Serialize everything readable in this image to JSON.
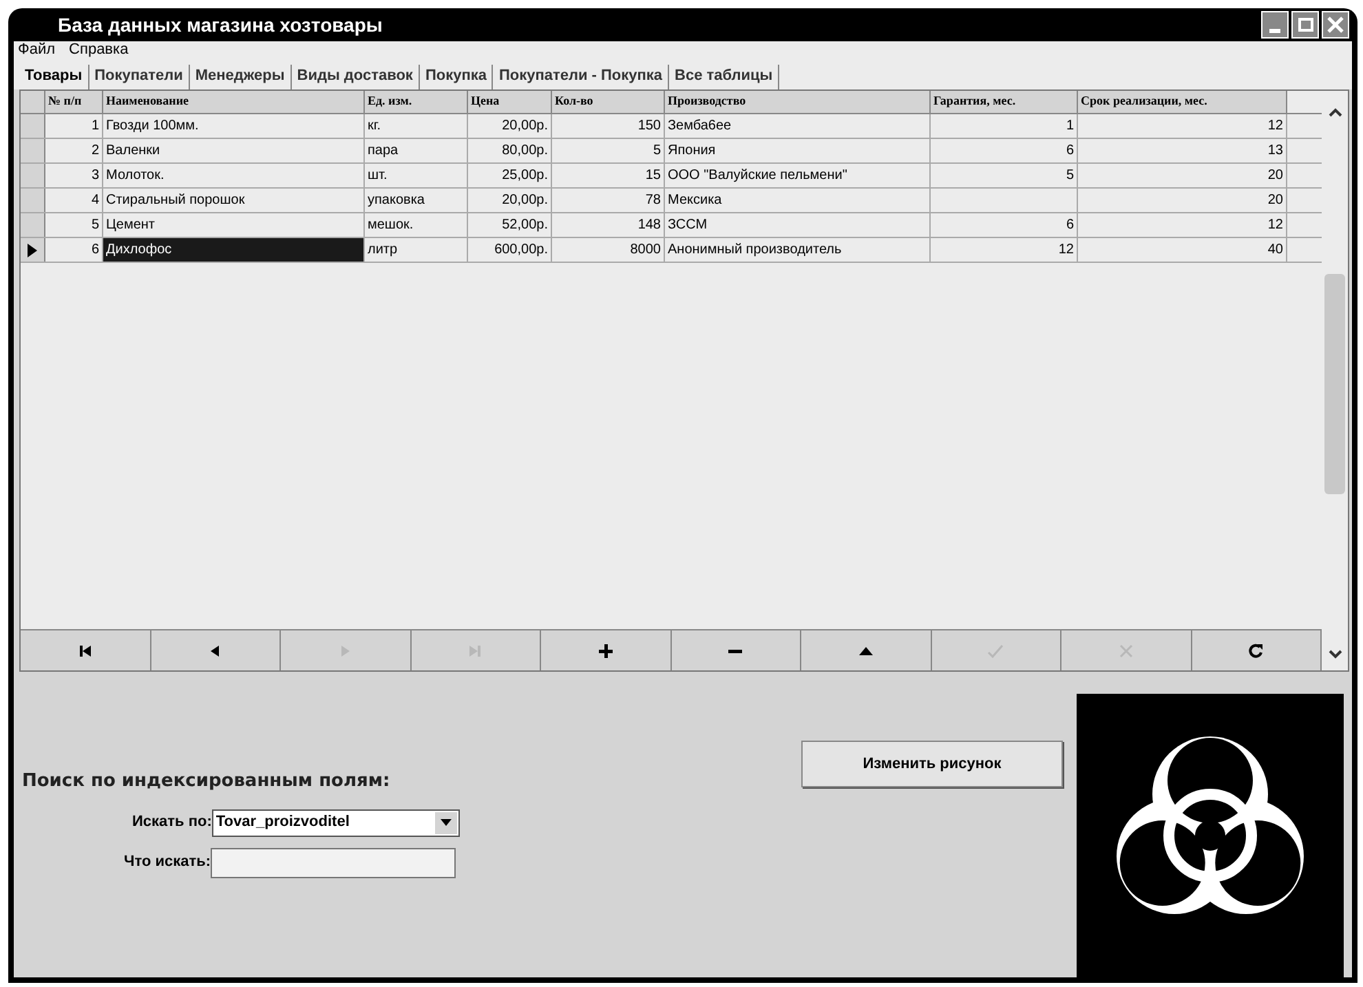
{
  "window": {
    "title": "База данных магазина хозтовары"
  },
  "menu": [
    "Файл",
    "Справка"
  ],
  "tabs": [
    {
      "label": "Товары",
      "selected": true
    },
    {
      "label": "Покупатели",
      "selected": false
    },
    {
      "label": "Менеджеры",
      "selected": false
    },
    {
      "label": "Виды доставок",
      "selected": false
    },
    {
      "label": "Покупка",
      "selected": false
    },
    {
      "label": "Покупатели - Покупка",
      "selected": false
    },
    {
      "label": "Все таблицы",
      "selected": false
    }
  ],
  "table": {
    "columns": [
      "№ п/п",
      "Наименование",
      "Ед. изм.",
      "Цена",
      "Кол-во",
      "Производство",
      "Гарантия, мес.",
      "Срок реализации, мес."
    ],
    "rows": [
      {
        "selected": false,
        "cells": [
          "1",
          "Гвозди 100мм.",
          "кг.",
          "20,00р.",
          "150",
          "Земба6ее",
          "1",
          "12"
        ]
      },
      {
        "selected": false,
        "cells": [
          "2",
          "Валенки",
          "пара",
          "80,00р.",
          "5",
          "Япония",
          "6",
          "13"
        ]
      },
      {
        "selected": false,
        "cells": [
          "3",
          "Молоток.",
          "шт.",
          "25,00р.",
          "15",
          "ООО \"Валуйские пельмени\"",
          "5",
          "20"
        ]
      },
      {
        "selected": false,
        "cells": [
          "4",
          "Стиральный порошок",
          "упаковка",
          "20,00р.",
          "78",
          "Мексика",
          "",
          "20"
        ]
      },
      {
        "selected": false,
        "cells": [
          "5",
          "Цемент",
          "мешок.",
          "52,00р.",
          "148",
          "ЗССМ",
          "6",
          "12"
        ]
      },
      {
        "selected": true,
        "cells": [
          "6",
          "Дихлофос",
          "литр",
          "600,00р.",
          "8000",
          "Анонимный производитель",
          "12",
          "40"
        ]
      }
    ]
  },
  "navigator": [
    {
      "kind": "first",
      "disabled": false
    },
    {
      "kind": "prior",
      "disabled": false
    },
    {
      "kind": "next",
      "disabled": true
    },
    {
      "kind": "last",
      "disabled": true
    },
    {
      "kind": "insert",
      "disabled": false
    },
    {
      "kind": "delete",
      "disabled": false
    },
    {
      "kind": "edit",
      "disabled": false
    },
    {
      "kind": "post",
      "disabled": true
    },
    {
      "kind": "cancel",
      "disabled": true
    },
    {
      "kind": "refresh",
      "disabled": false
    }
  ],
  "search": {
    "heading": "Поиск по индексированным полям:",
    "by_label": "Искать по:",
    "by_value": "Tovar_proizvoditel",
    "what_label": "Что искать:"
  },
  "change_picture_button": "Изменить рисунок"
}
